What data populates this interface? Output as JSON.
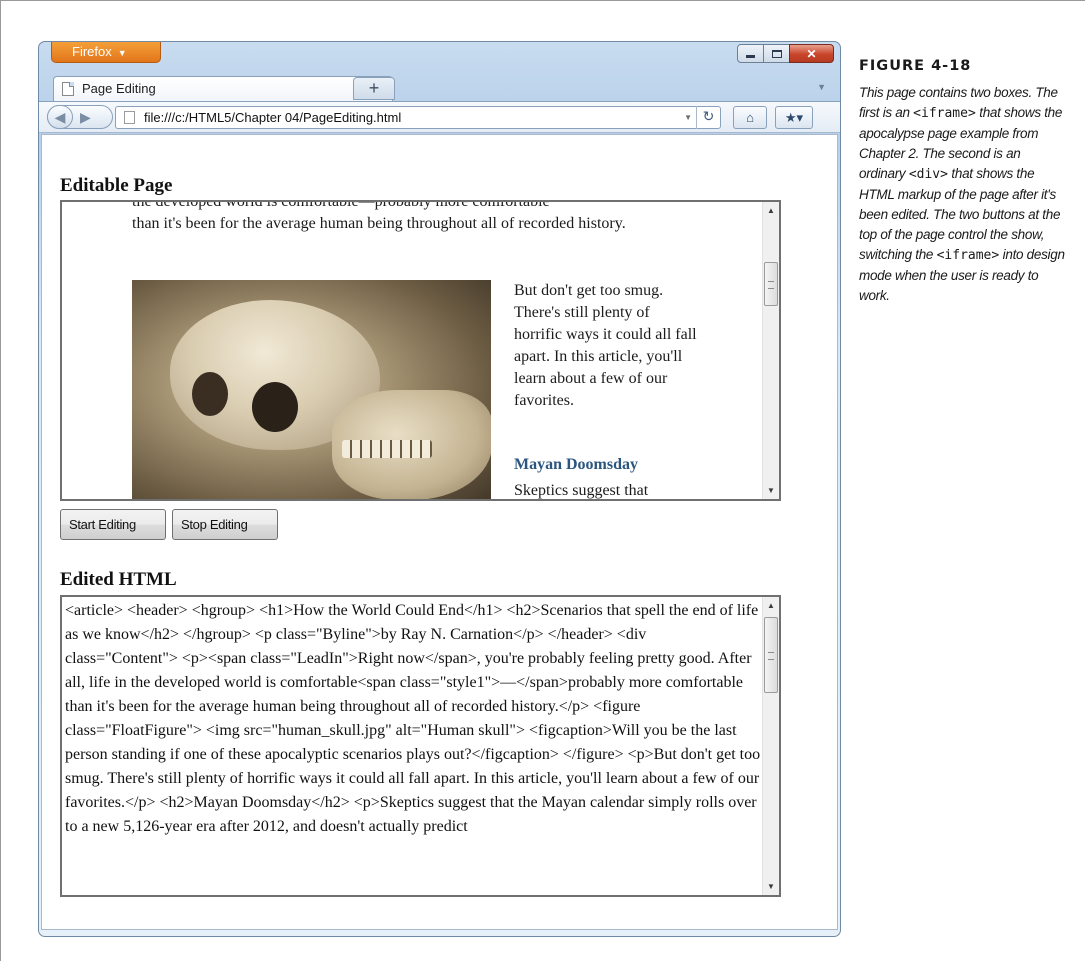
{
  "figure": {
    "title": "FIGURE 4-18",
    "caption": [
      {
        "t": "text",
        "v": "This page contains two boxes. The first is an "
      },
      {
        "t": "code",
        "v": "<iframe>"
      },
      {
        "t": "text",
        "v": " that shows the apocalypse page example from Chapter 2. The second is an ordinary "
      },
      {
        "t": "code",
        "v": "<div>"
      },
      {
        "t": "text",
        "v": " that shows the HTML markup of the page after it's been edited. The two buttons at the top of the page control the show, switching the "
      },
      {
        "t": "code",
        "v": "<iframe>"
      },
      {
        "t": "text",
        "v": " into design mode when the user is ready to work."
      }
    ]
  },
  "browser": {
    "app_button": "Firefox",
    "tab_title": "Page Editing",
    "new_tab_label": "+",
    "url": "file:///c:/HTML5/Chapter 04/PageEditing.html"
  },
  "page": {
    "editable_heading": "Editable Page",
    "edited_heading": "Edited HTML",
    "start_button": "Start Editing",
    "stop_button": "Stop Editing"
  },
  "iframe_content": {
    "top_line": "the developed world is comfortable—probably more comfortable",
    "para_lines": "than it's been for the average human being throughout all of recorded history.",
    "side_text": "But don't get too smug. There's still plenty of horrific ways it could all fall apart. In this article, you'll learn about a few of our favorites.",
    "subheading": "Mayan Doomsday",
    "cut_line": "Skeptics suggest that"
  },
  "edited_html": "<article> <header> <hgroup> <h1>How the World Could End</h1> <h2>Scenarios that spell the end of life as we know</h2> </hgroup> <p class=\"Byline\">by Ray N. Carnation</p> </header> <div class=\"Content\"> <p><span class=\"LeadIn\">Right now</span>, you're probably feeling pretty good. After all, life in the developed world is comfortable<span class=\"style1\">—</span>probably more comfortable than it's been for the average human being throughout all of recorded history.</p> <figure class=\"FloatFigure\"> <img src=\"human_skull.jpg\" alt=\"Human skull\"> <figcaption>Will you be the last person standing if one of these apocalyptic scenarios plays out?</figcaption> </figure> <p>But don't get too smug. There's still plenty of horrific ways it could all fall apart. In this article, you'll learn about a few of our favorites.</p> <h2>Mayan Doomsday</h2> <p>Skeptics suggest that the Mayan calendar simply rolls over to a new 5,126-year era after 2012, and doesn't actually predict"
}
